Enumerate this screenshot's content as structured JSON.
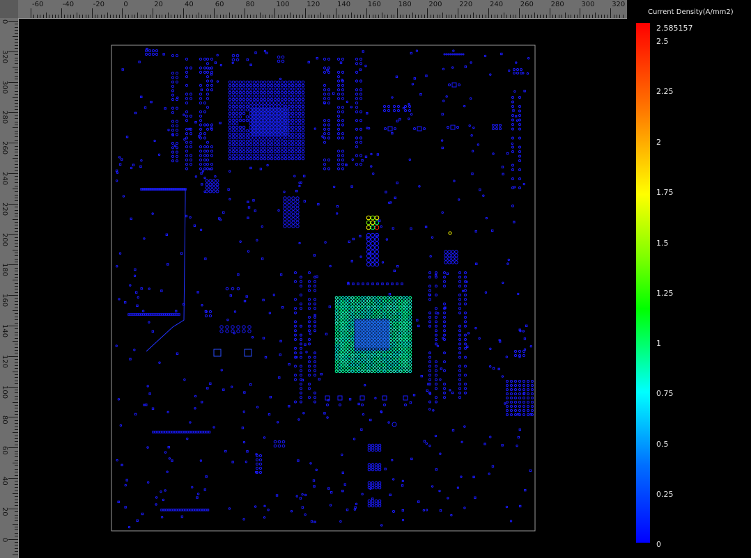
{
  "rulers": {
    "top_labels": [
      "-60",
      "-40",
      "-20",
      "0",
      "20",
      "40",
      "60",
      "80",
      "100",
      "120",
      "140",
      "160",
      "180",
      "200",
      "220",
      "240",
      "260",
      "280",
      "300",
      "320"
    ],
    "left_labels": [
      "0",
      "320",
      "300",
      "280",
      "260",
      "240",
      "220",
      "200",
      "180",
      "160",
      "140",
      "120",
      "100",
      "80",
      "60",
      "40",
      "20",
      "0"
    ]
  },
  "legend": {
    "title": "Current Density(A/mm2)",
    "max_label": "2.585157",
    "labels": [
      "2.5",
      "2.25",
      "2",
      "1.75",
      "1.5",
      "1.25",
      "1",
      "0.75",
      "0.5",
      "0.25",
      "0"
    ],
    "colors": {
      "min": "#0000ff",
      "mid": "#00ffff",
      "high": "#ffff00",
      "max": "#ff0000"
    }
  },
  "colors": {
    "background": "#000000",
    "ruler": "#6e6e6e",
    "board_outline": "#9a9a9a",
    "via_low": "#1a1aff",
    "via_mid": "#00e0c0",
    "via_hot": "#ff2a00"
  }
}
